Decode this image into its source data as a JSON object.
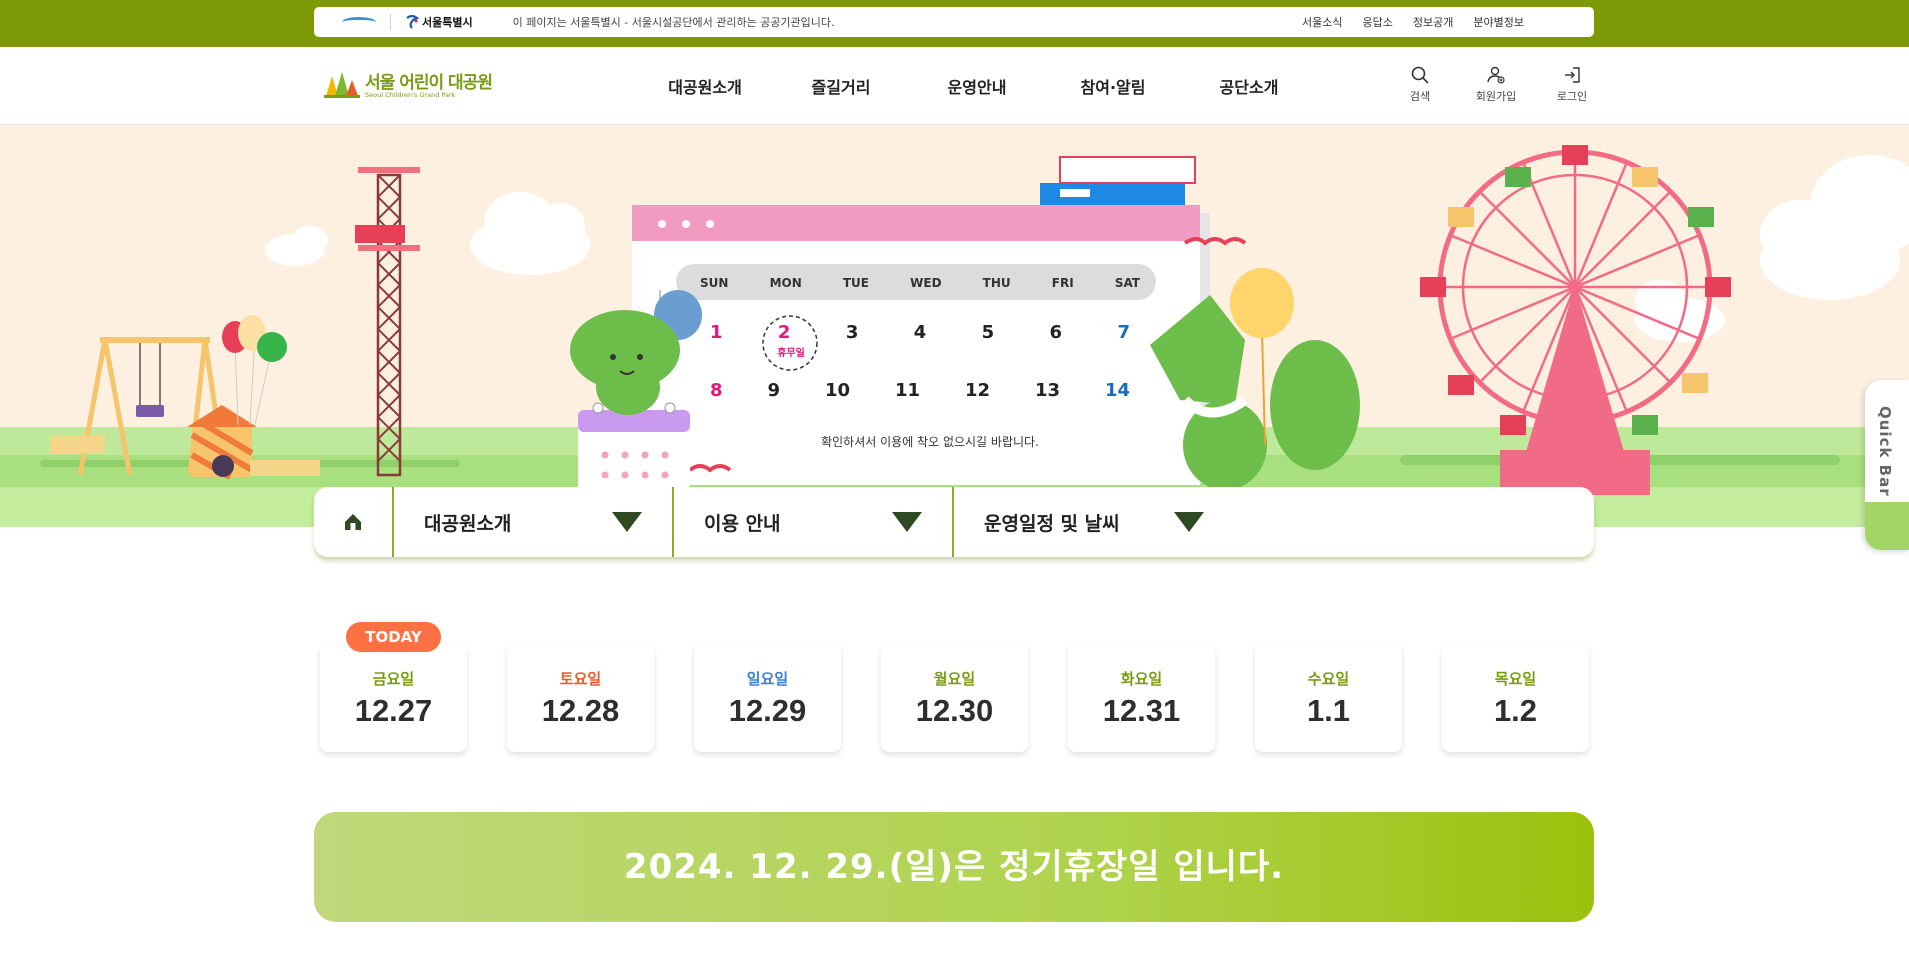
{
  "topbar": {
    "seoul_logo_label": "서울특별시",
    "gov_notice": "이 페이지는 서울특별시 - 서울시설공단에서 관리하는 공공기관입니다.",
    "links": [
      "서울소식",
      "응답소",
      "정보공개",
      "분야별정보"
    ]
  },
  "header": {
    "logo_ko": "서울 어린이 대공원",
    "logo_en": "Seoul Children's Grand Park",
    "menu": [
      "대공원소개",
      "즐길거리",
      "운영안내",
      "참여·알림",
      "공단소개"
    ],
    "utils": [
      {
        "label": "검색",
        "icon": "search-icon"
      },
      {
        "label": "회원가입",
        "icon": "user-add-icon"
      },
      {
        "label": "로그인",
        "icon": "login-icon"
      }
    ]
  },
  "hero": {
    "calendar_days": [
      "SUN",
      "MON",
      "TUE",
      "WED",
      "THU",
      "FRI",
      "SAT"
    ],
    "week1": [
      "1",
      "2",
      "3",
      "4",
      "5",
      "6",
      "7"
    ],
    "week2": [
      "8",
      "9",
      "10",
      "11",
      "12",
      "13",
      "14"
    ],
    "holiday_label": "휴무일",
    "calendar_note": "확인하셔서 이용에 착오 없으시길 바랍니다."
  },
  "quickbar": {
    "label": "Quick Bar"
  },
  "location": {
    "items": [
      "대공원소개",
      "이용 안내",
      "운영일정 및 날씨"
    ]
  },
  "today_label": "TODAY",
  "dates": [
    {
      "dow": "금요일",
      "date": "12.27",
      "color": "#7a9b14"
    },
    {
      "dow": "토요일",
      "date": "12.28",
      "color": "#f05a28"
    },
    {
      "dow": "일요일",
      "date": "12.29",
      "color": "#3f7fd8"
    },
    {
      "dow": "월요일",
      "date": "12.30",
      "color": "#7a9b14"
    },
    {
      "dow": "화요일",
      "date": "12.31",
      "color": "#7a9b14"
    },
    {
      "dow": "수요일",
      "date": "1.1",
      "color": "#7a9b14"
    },
    {
      "dow": "목요일",
      "date": "1.2",
      "color": "#7a9b14"
    }
  ],
  "notice": "2024. 12. 29.(일)은 정기휴장일 입니다.",
  "colors": {
    "topbar": "#7d9a06",
    "accent_green": "#7a9b14",
    "today_badge": "#ff7043"
  }
}
